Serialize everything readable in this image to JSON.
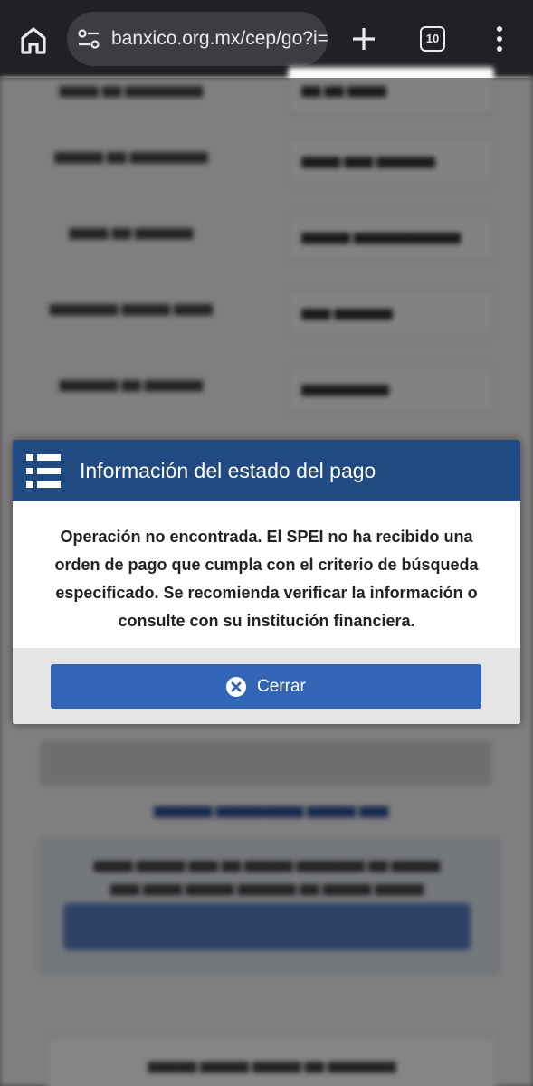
{
  "browser": {
    "url": "banxico.org.mx/cep/go?i=",
    "tab_count": "10",
    "icons": {
      "home": "home-icon",
      "site_settings": "tune-icon",
      "new_tab": "plus-icon",
      "menu": "more-vert-icon"
    }
  },
  "modal": {
    "title": "Información del estado del pago",
    "message": "Operación no encontrada. El SPEI no ha recibido una orden de pago que cumpla con el criterio de búsqueda especificado. Se recomienda verificar la información o consulte con su institución financiera.",
    "close_label": "Cerrar",
    "colors": {
      "header": "#224a82",
      "button": "#3265b6",
      "footer": "#e5e5e5"
    }
  }
}
